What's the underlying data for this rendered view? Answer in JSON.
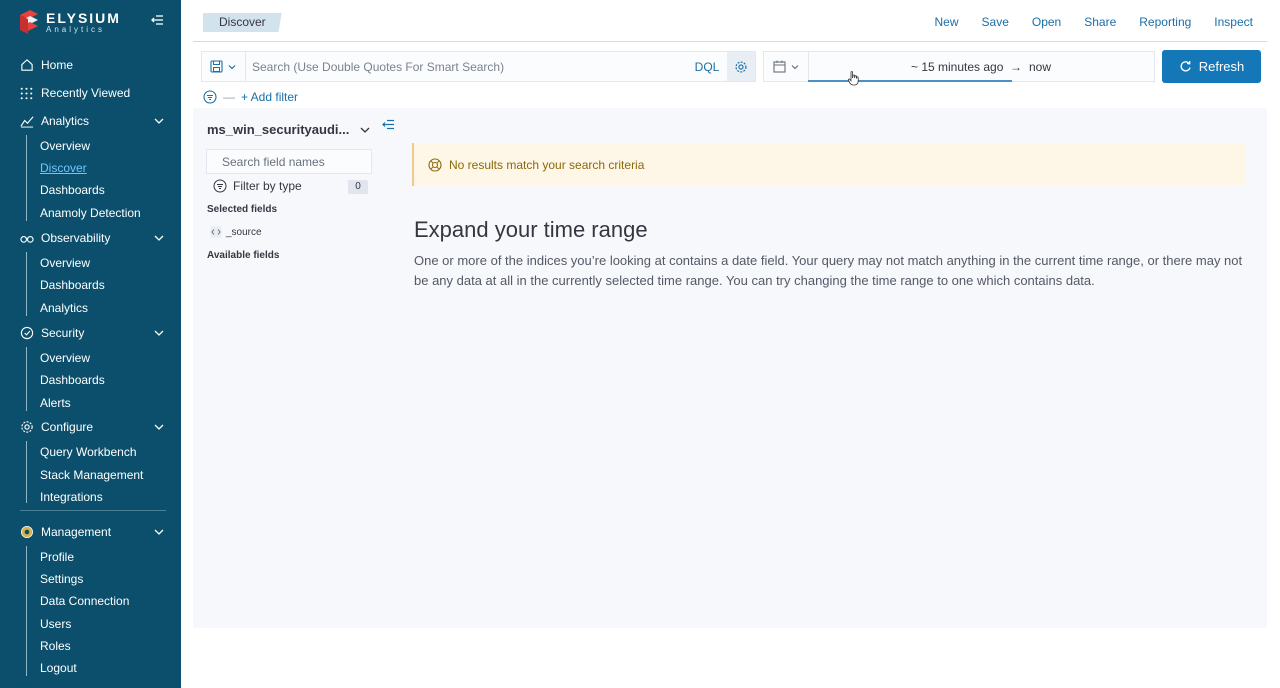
{
  "brand": {
    "name": "ELYSIUM",
    "sub": "Analytics"
  },
  "nav": {
    "home": "Home",
    "recently_viewed": "Recently Viewed",
    "analytics": {
      "label": "Analytics",
      "items": [
        "Overview",
        "Discover",
        "Dashboards",
        "Anamoly Detection"
      ]
    },
    "observability": {
      "label": "Observability",
      "items": [
        "Overview",
        "Dashboards",
        "Analytics"
      ]
    },
    "security": {
      "label": "Security",
      "items": [
        "Overview",
        "Dashboards",
        "Alerts"
      ]
    },
    "configure": {
      "label": "Configure",
      "items": [
        "Query Workbench",
        "Stack Management",
        "Integrations"
      ]
    },
    "management": {
      "label": "Management",
      "items": [
        "Profile",
        "Settings",
        "Data Connection",
        "Users",
        "Roles",
        "Logout"
      ]
    },
    "active_item": "Discover"
  },
  "header": {
    "breadcrumb": "Discover",
    "actions": [
      "New",
      "Save",
      "Open",
      "Share",
      "Reporting",
      "Inspect"
    ]
  },
  "query": {
    "placeholder": "Search (Use Double Quotes For Smart Search)",
    "language": "DQL"
  },
  "time": {
    "start": "~ 15 minutes ago",
    "arrow": "→",
    "end": "now"
  },
  "refresh_label": "Refresh",
  "filter": {
    "add_label": "+ Add filter"
  },
  "sidebar_fields": {
    "index_pattern": "ms_win_securityaudi...",
    "search_placeholder": "Search field names",
    "filter_by_type": "Filter by type",
    "filter_count": "0",
    "selected_label": "Selected fields",
    "selected": [
      "_source"
    ],
    "available_label": "Available fields"
  },
  "results": {
    "callout": "No results match your search criteria",
    "title": "Expand your time range",
    "body": "One or more of the indices you’re looking at contains a date field. Your query may not match anything in the current time range, or there may not be any data at all in the currently selected time range. You can try changing the time range to one which contains data."
  },
  "colors": {
    "sidebar": "#0b4f6c",
    "accent": "#1477b8",
    "link": "#1a6fa8",
    "warning_bg": "#fef6e6"
  }
}
